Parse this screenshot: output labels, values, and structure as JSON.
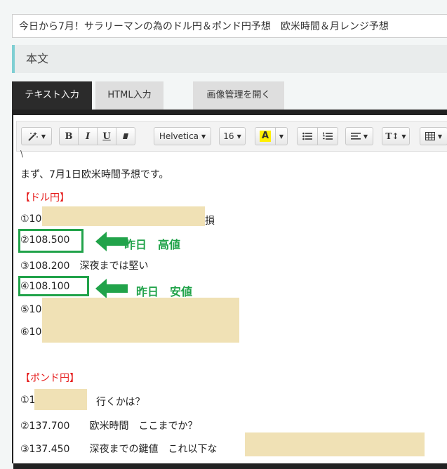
{
  "post": {
    "title_value": "今日から7月！サラリーマンの為のドル円＆ポンド円予想　欧米時間＆月レンジ予想",
    "section_label": "本文"
  },
  "tabs": {
    "text_input": "テキスト入力",
    "html_input": "HTML入力",
    "image_manager": "画像管理を開く"
  },
  "toolbar": {
    "font_family": "Helvetica",
    "font_size": "16",
    "highlight_letter": "A",
    "text_size_label": "T↕",
    "bold": "B",
    "italic": "I",
    "underline": "U",
    "icons": [
      "magic-wand-icon",
      "eraser-icon",
      "bullet-list-icon",
      "numbered-list-icon",
      "align-icon",
      "table-icon",
      "chevron-down-icon"
    ]
  },
  "body": {
    "partial_top": "\\",
    "intro": "まず、7月1日欧米時間予想です。",
    "usd_heading": "【ドル円】",
    "usd": [
      {
        "label": "①10",
        "suffix": "損"
      },
      {
        "label": "②108.500"
      },
      {
        "label": "③108.200　深夜までは堅い"
      },
      {
        "label": "④108.100"
      },
      {
        "label": "⑤10"
      },
      {
        "label": "⑥10"
      }
    ],
    "usd_annotations": {
      "high": "昨日　高値",
      "low": "昨日　安値"
    },
    "gbp_heading": "【ポンド円】",
    "gbp": [
      {
        "label": "①1",
        "suffix": "行くかは？"
      },
      {
        "label": "②137.700　　欧米時間　ここまでか？"
      },
      {
        "label": "③137.450　　深夜までの鍵値　これ以下な"
      }
    ]
  },
  "colors": {
    "accent_teal": "#7fcfd3",
    "tab_active": "#2b2b2b",
    "annotation_green": "#21a34a",
    "heading_red": "#e51b1b",
    "redaction": "#f0e1b5"
  }
}
